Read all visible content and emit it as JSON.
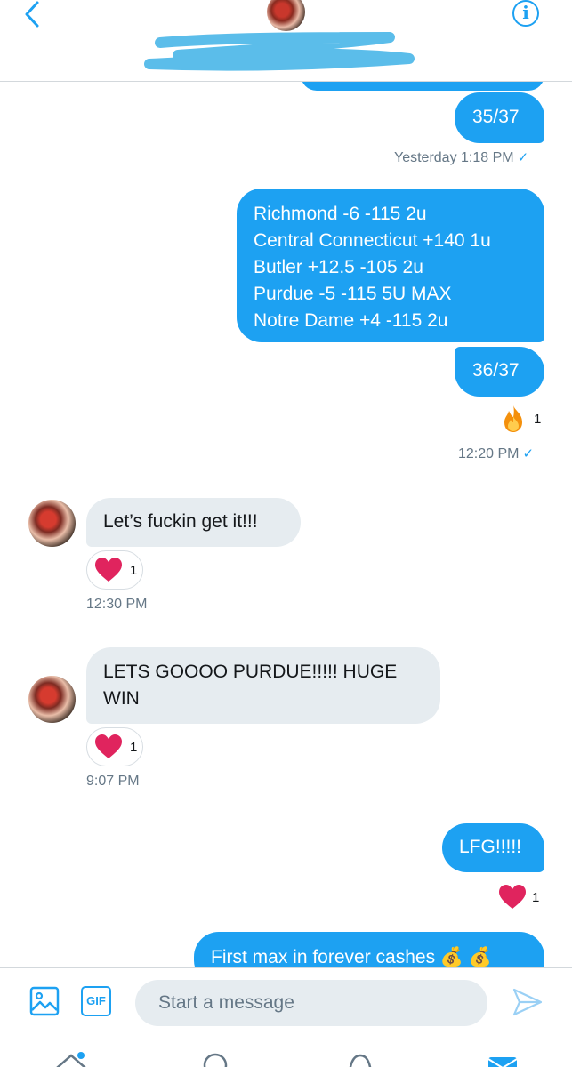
{
  "compose": {
    "placeholder": "Start a message",
    "gif_label": "GIF"
  },
  "messages": {
    "m0": {
      "text": "35/37",
      "meta": "Yesterday 1:18 PM"
    },
    "m1": {
      "lines": [
        "Richmond -6 -115 2u",
        "Central Connecticut +140 1u",
        "Butler +12.5 -105 2u",
        "Purdue -5 -115 5U MAX",
        "Notre Dame +4 -115 2u"
      ]
    },
    "m2": {
      "text": "36/37",
      "reaction_count": "1",
      "meta": "12:20 PM"
    },
    "m3": {
      "text": "Let’s fuckin get it!!!",
      "reaction_count": "1",
      "meta": "12:30 PM"
    },
    "m4": {
      "text": "LETS GOOOO PURDUE!!!!! HUGE WIN",
      "reaction_count": "1",
      "meta": "9:07 PM"
    },
    "m5": {
      "text": "LFG!!!!!",
      "reaction_count": "1"
    },
    "m6": {
      "text": "First max in forever cashes 💰 💰"
    }
  },
  "icons": {
    "back": "chevron-left-icon",
    "info": "info-icon",
    "media": "image-icon",
    "send": "send-icon",
    "heart": "heart-icon",
    "fire": "fire-icon"
  },
  "colors": {
    "accent": "#1da1f2",
    "incoming_bubble": "#e6ecf0",
    "heart": "#e0245e"
  }
}
